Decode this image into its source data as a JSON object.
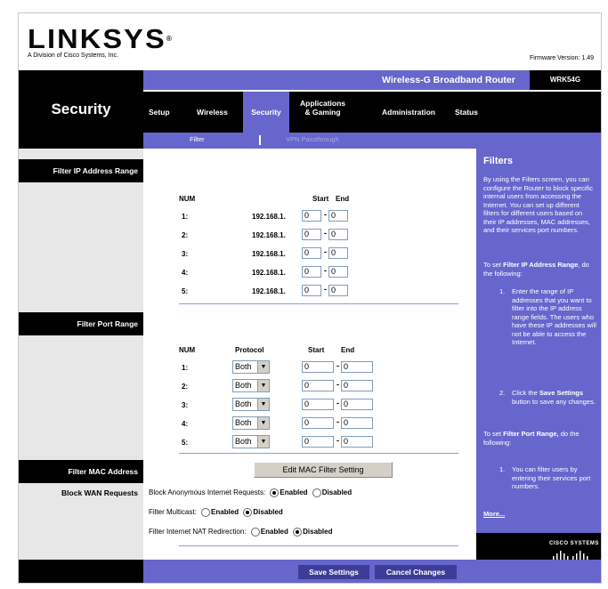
{
  "header": {
    "brand": "LINKSYS",
    "brand_mark": "®",
    "brand_sub": "A Division of Cisco Systems, Inc.",
    "firmware": "Firmware Version: 1.49"
  },
  "band": {
    "section_title": "Security",
    "product_name": "Wireless-G Broadband Router",
    "model": "WRK54G"
  },
  "tabs": [
    "Setup",
    "Wireless",
    "Security",
    "Applications & Gaming",
    "Administration",
    "Status"
  ],
  "tab_apps_line1": "Applications",
  "tab_apps_line2": "& Gaming",
  "subtabs": {
    "filter": "Filter",
    "vpn": "VPN Passthrough"
  },
  "left": {
    "filter_ip": "Filter IP Address Range",
    "filter_port": "Filter Port Range",
    "filter_mac": "Filter MAC Address",
    "block_wan": "Block WAN Requests"
  },
  "ip_table": {
    "headers": {
      "num": "NUM",
      "start": "Start",
      "end": "End"
    },
    "prefix": "192.168.1.",
    "rows": [
      {
        "num": "1:",
        "start": "0",
        "end": "0"
      },
      {
        "num": "2:",
        "start": "0",
        "end": "0"
      },
      {
        "num": "3:",
        "start": "0",
        "end": "0"
      },
      {
        "num": "4:",
        "start": "0",
        "end": "0"
      },
      {
        "num": "5:",
        "start": "0",
        "end": "0"
      }
    ]
  },
  "port_table": {
    "headers": {
      "num": "NUM",
      "protocol": "Protocol",
      "start": "Start",
      "end": "End"
    },
    "rows": [
      {
        "num": "1:",
        "protocol": "Both",
        "start": "0",
        "end": "0"
      },
      {
        "num": "2:",
        "protocol": "Both",
        "start": "0",
        "end": "0"
      },
      {
        "num": "3:",
        "protocol": "Both",
        "start": "0",
        "end": "0"
      },
      {
        "num": "4:",
        "protocol": "Both",
        "start": "0",
        "end": "0"
      },
      {
        "num": "5:",
        "protocol": "Both",
        "start": "0",
        "end": "0"
      }
    ]
  },
  "mac": {
    "button": "Edit MAC Filter Setting"
  },
  "wan": {
    "anon_label": "Block Anonymous Internet Requests:",
    "multicast_label": "Filter Multicast:",
    "nat_label": "Filter Internet NAT Redirection:",
    "enabled": "Enabled",
    "disabled": "Disabled"
  },
  "help": {
    "title": "Filters",
    "intro": "By using the Filters screen, you can configure the Router to block specific internal users from accessing the Internet. You can set up different filters for different users based on their IP addresses, MAC addresses, and their services port numbers.",
    "ip_pre": "To set ",
    "ip_bold": "Filter IP Address Range",
    "ip_post": ", do the following:",
    "ip_step1_num": "1.",
    "ip_step1": "Enter the range of IP addresses that you want to filter into the IP address range fields. The users who have these IP addresses will not be able to access the Internet.",
    "ip_step2_num": "2.",
    "ip_step2_pre": "Click the ",
    "ip_step2_bold": "Save Settings",
    "ip_step2_post": " button to save any changes.",
    "port_pre": "To set ",
    "port_bold": "Filter Port Range,",
    "port_post": " do the following:",
    "port_step1_num": "1.",
    "port_step1": "You can filter users by entering their services port numbers.",
    "more": "More...",
    "cisco": "CISCO SYSTEMS"
  },
  "footer": {
    "save": "Save Settings",
    "cancel": "Cancel Changes"
  },
  "colors": {
    "accent": "#6666cc",
    "dark": "#000000",
    "panel": "#e7e7e7",
    "button": "#3d3d99"
  }
}
